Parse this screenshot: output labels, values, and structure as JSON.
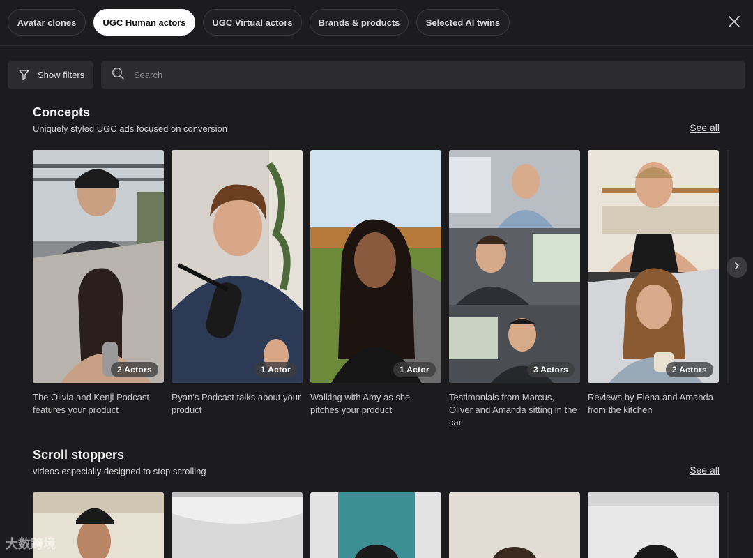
{
  "tabs": [
    {
      "label": "Avatar clones",
      "active": false
    },
    {
      "label": "UGC Human actors",
      "active": true
    },
    {
      "label": "UGC Virtual actors",
      "active": false
    },
    {
      "label": "Brands & products",
      "active": false
    },
    {
      "label": "Selected AI twins",
      "active": false
    }
  ],
  "toolbar": {
    "filter_label": "Show filters",
    "search_placeholder": "Search",
    "search_value": ""
  },
  "concepts": {
    "title": "Concepts",
    "subtitle": "Uniquely styled UGC ads focused on conversion",
    "see_all": "See all",
    "cards": [
      {
        "badge": "2 Actors",
        "caption": "The Olivia and Kenji Podcast features your product"
      },
      {
        "badge": "1 Actor",
        "caption": "Ryan's Podcast talks about your product"
      },
      {
        "badge": "1 Actor",
        "caption": "Walking with Amy as she pitches your product"
      },
      {
        "badge": "3 Actors",
        "caption": "Testimonials from Marcus, Oliver and Amanda sitting in the car"
      },
      {
        "badge": "2 Actors",
        "caption": "Reviews by Elena and Amanda from the kitchen"
      }
    ]
  },
  "scroll_stoppers": {
    "title": "Scroll stoppers",
    "subtitle": "videos especially designed to stop scrolling",
    "see_all": "See all"
  },
  "watermark": "大数跨境",
  "colors": {
    "background": "#1c1c1e",
    "active_tab_bg": "#ffffff",
    "input_bg": "#2c2c2f"
  }
}
